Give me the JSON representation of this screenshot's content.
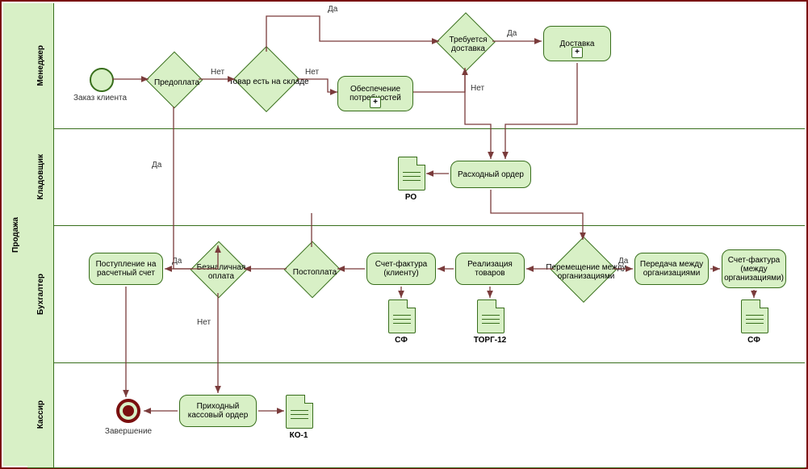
{
  "pool": "Продажа",
  "lanes": {
    "l1": "Менеджер",
    "l2": "Кладовщик",
    "l3": "Бухгалтер",
    "l4": "Кассир"
  },
  "start_caption": "Заказ клиента",
  "end_caption": "Завершение",
  "gateways": {
    "g_prepay": "Предоплата",
    "g_stock": "Товар есть на складе",
    "g_delivery": "Требуется доставка",
    "g_cashless": "Безналичная оплата",
    "g_postpay": "Постоплата",
    "g_interorg": "Перемещение между организациями"
  },
  "tasks": {
    "t_supply": "Обеспечение потребностей",
    "t_delivery": "Доставка",
    "t_ro": "Расходный ордер",
    "t_bank": "Поступление на расчетный счет",
    "t_sf_client": "Счет-фактура (клиенту)",
    "t_real": "Реализация товаров",
    "t_transfer": "Передача между организациями",
    "t_sf_org": "Счет-фактура (между организациями)",
    "t_pko": "Приходный кассовый ордер"
  },
  "docs": {
    "d_ro": "РО",
    "d_sf1": "СФ",
    "d_torg": "ТОРГ-12",
    "d_sf2": "СФ",
    "d_ko": "КО-1"
  },
  "edge": {
    "yes": "Да",
    "no": "Нет"
  }
}
